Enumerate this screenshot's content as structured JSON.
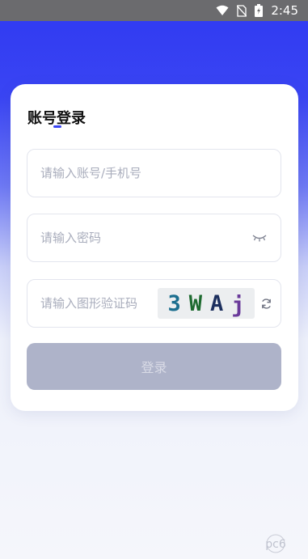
{
  "status_bar": {
    "time": "2:45",
    "icons": [
      "wifi-icon",
      "no-sim-icon",
      "battery-charging-icon"
    ]
  },
  "login": {
    "title": "账号登录",
    "account_placeholder": "请输入账号/手机号",
    "password_placeholder": "请输入密码",
    "captcha_placeholder": "请输入图形验证码",
    "captcha_chars": [
      "3",
      "W",
      "A",
      "j"
    ],
    "login_button": "登录",
    "icons": [
      "eye-closed-icon",
      "refresh-icon"
    ]
  },
  "colors": {
    "accent": "#3a45f3",
    "button_disabled": "#aeb3c9"
  },
  "watermark": "pc6"
}
